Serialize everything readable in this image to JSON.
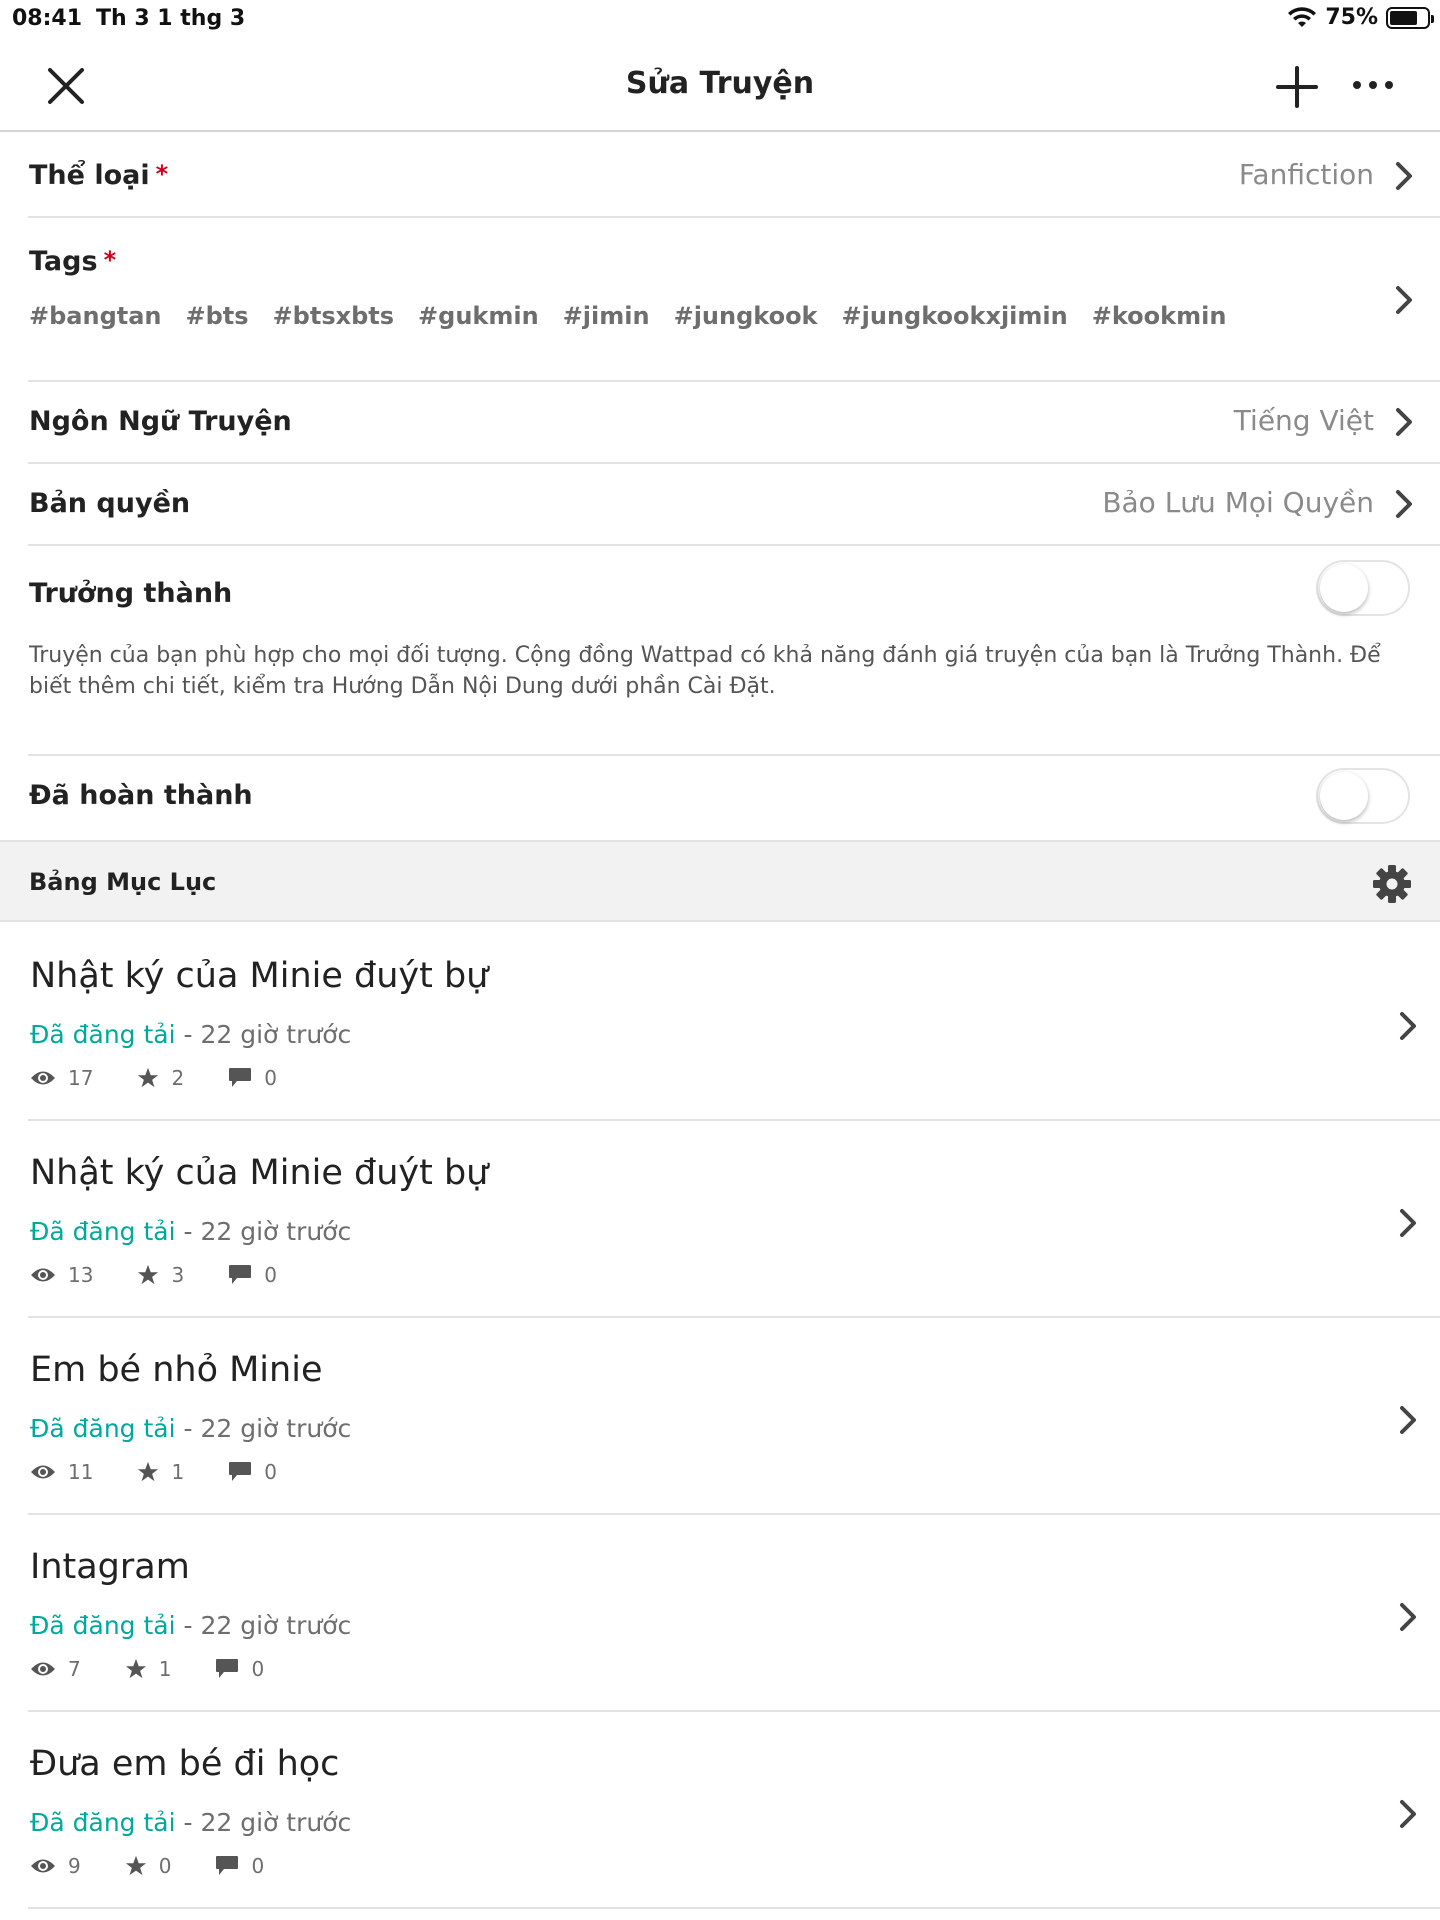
{
  "status_bar": {
    "time": "08:41",
    "date": "Th 3 1 thg 3",
    "battery": "75%",
    "battery_level": 0.75
  },
  "nav": {
    "title": "Sửa Truyện",
    "close_icon": "close-icon",
    "add_icon": "plus-icon",
    "more_icon": "more-icon"
  },
  "genre": {
    "label": "Thể loại",
    "required": "*",
    "value": "Fanfiction"
  },
  "tags": {
    "label": "Tags",
    "required": "*",
    "items": [
      "#bangtan",
      "#bts",
      "#btsxbts",
      "#gukmin",
      "#jimin",
      "#jungkook",
      "#jungkookxjimin",
      "#kookmin"
    ]
  },
  "language": {
    "label": "Ngôn Ngữ Truyện",
    "value": "Tiếng Việt"
  },
  "copyright": {
    "label": "Bản quyền",
    "value": "Bảo Lưu Mọi Quyền"
  },
  "mature": {
    "label": "Trưởng thành",
    "enabled": false,
    "description": "Truyện của bạn phù hợp cho mọi đối tượng. Cộng đồng Wattpad có khả năng đánh giá truyện của bạn là Trưởng Thành. Để biết thêm chi tiết, kiểm tra Hướng Dẫn Nội Dung dưới phần Cài Đặt."
  },
  "completed": {
    "label": "Đã hoàn thành",
    "enabled": false
  },
  "toc": {
    "title": "Bảng Mục Lục",
    "parts": [
      {
        "title": "Nhật ký của Minie đuýt bự",
        "status": "Đã đăng tải",
        "time": " - 22 giờ trước",
        "views": "17",
        "votes": "2",
        "comments": "0"
      },
      {
        "title": "Nhật ký của Minie đuýt bự",
        "status": "Đã đăng tải",
        "time": " - 22 giờ trước",
        "views": "13",
        "votes": "3",
        "comments": "0"
      },
      {
        "title": "Em bé nhỏ Minie",
        "status": "Đã đăng tải",
        "time": " - 22 giờ trước",
        "views": "11",
        "votes": "1",
        "comments": "0"
      },
      {
        "title": "Intagram",
        "status": "Đã đăng tải",
        "time": " - 22 giờ trước",
        "views": "7",
        "votes": "1",
        "comments": "0"
      },
      {
        "title": "Đưa em bé đi học",
        "status": "Đã đăng tải",
        "time": " - 22 giờ trước",
        "views": "9",
        "votes": "0",
        "comments": "0"
      }
    ]
  },
  "colors": {
    "accent": "#00a99d",
    "required": "#d0021b",
    "muted": "#8a8a8a",
    "divider": "#e2e2e2"
  }
}
